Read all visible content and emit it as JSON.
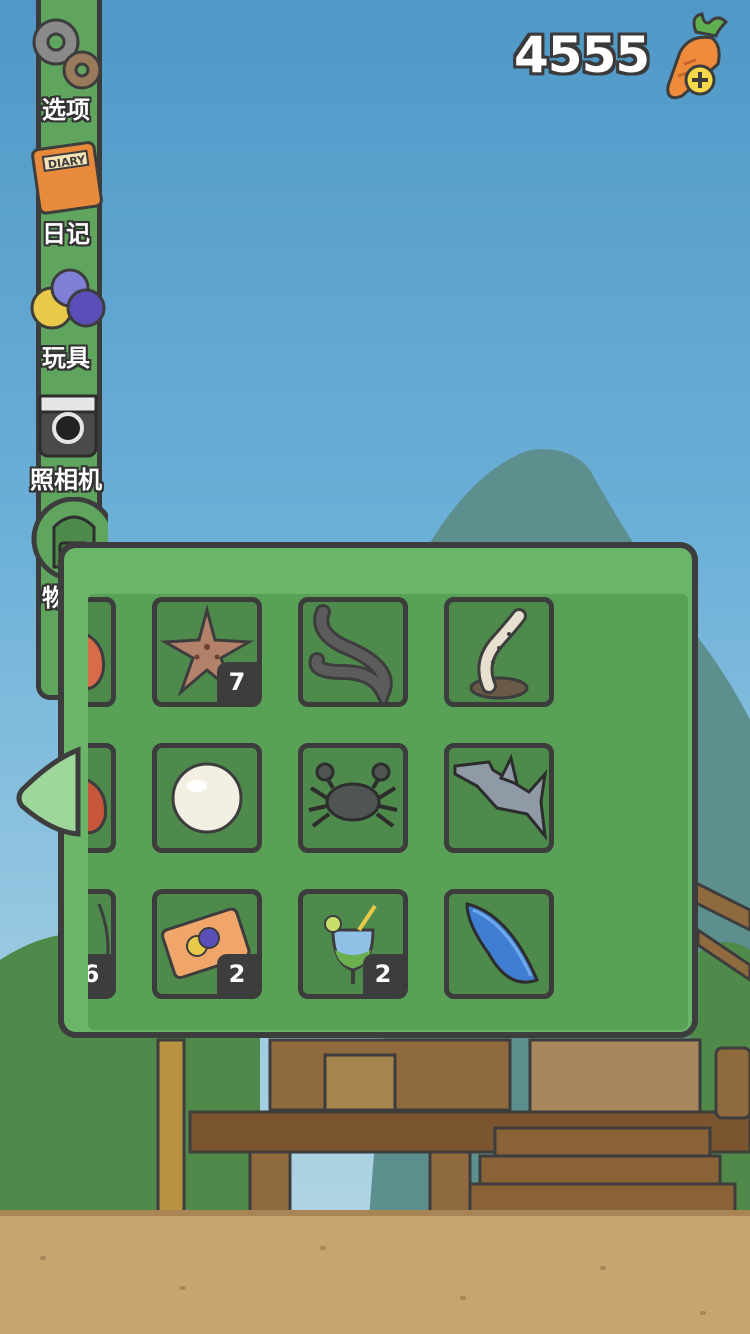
{
  "colors": {
    "panel": "#6bb569",
    "slot": "#4d8a4b",
    "outline": "#3d3d3d"
  },
  "currency": {
    "amount": "4555",
    "icon": "carrot-plus-icon"
  },
  "menu": {
    "items": [
      {
        "label": "选项",
        "icon": "gears-icon"
      },
      {
        "label": "日记",
        "icon": "diary-icon"
      },
      {
        "label": "玩具",
        "icon": "toy-balls-icon"
      },
      {
        "label": "照相机",
        "icon": "camera-icon"
      },
      {
        "label": "物品",
        "icon": "backpack-icon"
      }
    ]
  },
  "inventory": {
    "rows": [
      [
        {
          "item": "shrimp-icon",
          "count": ""
        },
        {
          "item": "starfish-icon",
          "count": "7"
        },
        {
          "item": "eel-icon",
          "count": ""
        },
        {
          "item": "moray-eel-icon",
          "count": ""
        }
      ],
      [
        {
          "item": "hermit-crab-icon",
          "count": ""
        },
        {
          "item": "pearl-icon",
          "count": ""
        },
        {
          "item": "crab-icon",
          "count": ""
        },
        {
          "item": "hammerhead-shark-icon",
          "count": ""
        }
      ],
      [
        {
          "item": "partial-item-icon",
          "count": "6"
        },
        {
          "item": "ticket-icon",
          "count": "2"
        },
        {
          "item": "cocktail-icon",
          "count": "2"
        },
        {
          "item": "surfboard-icon",
          "count": ""
        }
      ]
    ]
  }
}
